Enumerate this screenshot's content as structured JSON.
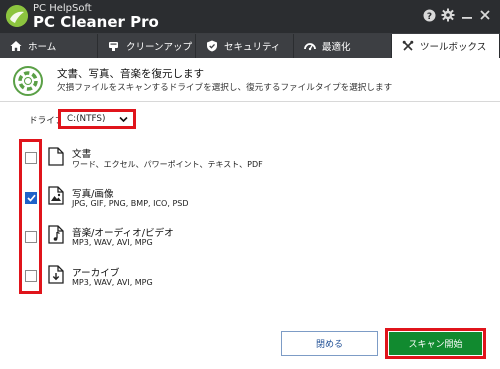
{
  "app": {
    "brand_small": "PC HelpSoft",
    "brand_big": "PC Cleaner Pro"
  },
  "window_controls": [
    {
      "icon": "help-icon"
    },
    {
      "icon": "gear-icon"
    },
    {
      "icon": "minimize-icon"
    },
    {
      "icon": "close-icon"
    }
  ],
  "tabs": [
    {
      "label": "ホーム",
      "icon": "home-icon",
      "active": false
    },
    {
      "label": "クリーンアップ",
      "icon": "broom-icon",
      "active": false
    },
    {
      "label": "セキュリティ",
      "icon": "shield-icon",
      "active": false
    },
    {
      "label": "最適化",
      "icon": "gauge-icon",
      "active": false
    },
    {
      "label": "ツールボックス",
      "icon": "wrench-icon",
      "active": true
    }
  ],
  "header": {
    "title": "文書、写真、音楽を復元します",
    "subtitle": "欠損ファイルをスキャンするドライブを選択し、復元するファイルタイプを選択します",
    "icon": "lifebuoy-icon"
  },
  "drive": {
    "label": "ドライブ",
    "selected": "C:(NTFS)"
  },
  "file_types": [
    {
      "title": "文書",
      "exts": "ワード、エクセル、パワーポイント、テキスト、PDF",
      "checked": false,
      "icon": "document-icon"
    },
    {
      "title": "写真/画像",
      "exts": "JPG, GIF, PNG, BMP, ICO, PSD",
      "checked": true,
      "icon": "image-icon"
    },
    {
      "title": "音楽/オーディオ/ビデオ",
      "exts": "MP3, WAV, AVI, MPG",
      "checked": false,
      "icon": "music-icon"
    },
    {
      "title": "アーカイブ",
      "exts": "MP3, WAV, AVI, MPG",
      "checked": false,
      "icon": "archive-icon"
    }
  ],
  "buttons": {
    "close": "閉める",
    "scan": "スキャン開始"
  },
  "colors": {
    "titlebar": "#2b2d30",
    "tab": "#3d3f43",
    "accent_green": "#118a2f",
    "highlight_red": "#e0141b",
    "checkbox_blue": "#1f62c9"
  }
}
